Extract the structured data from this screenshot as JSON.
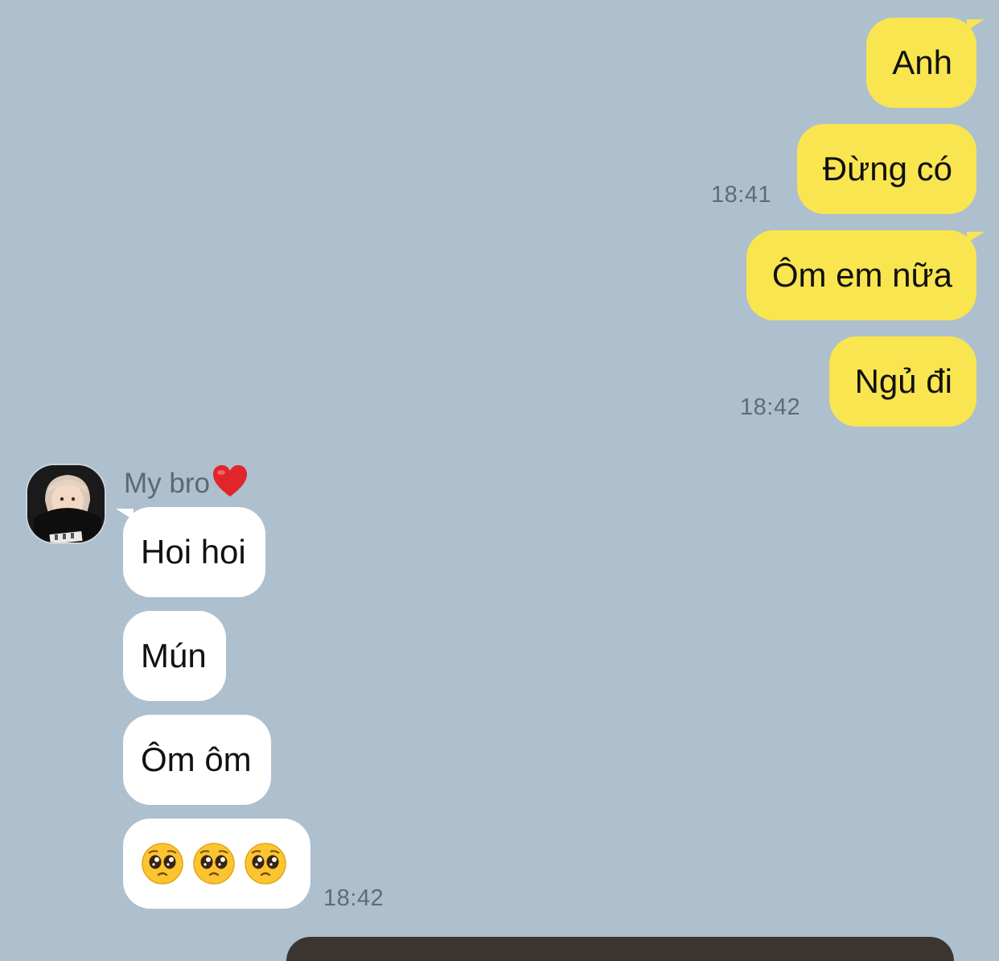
{
  "colors": {
    "background": "#aebfce",
    "outgoing_bubble": "#f9e54f",
    "incoming_bubble": "#ffffff",
    "timestamp_text": "#5f6c78"
  },
  "outgoing": [
    {
      "text": "Anh"
    },
    {
      "text": "Đừng có",
      "time": "18:41"
    },
    {
      "text": "Ôm em nữa"
    },
    {
      "text": "Ngủ đi",
      "time": "18:42"
    }
  ],
  "contact": {
    "name": "My bro",
    "name_icon": "red-heart-icon",
    "avatar_icon": "profile-photo"
  },
  "incoming": [
    {
      "text": "Hoi hoi"
    },
    {
      "text": "Mún"
    },
    {
      "text": "Ôm ôm"
    },
    {
      "text": "🥺🥺🥺",
      "emoji": [
        "pleading-face-icon",
        "pleading-face-icon",
        "pleading-face-icon"
      ],
      "time": "18:42"
    }
  ]
}
